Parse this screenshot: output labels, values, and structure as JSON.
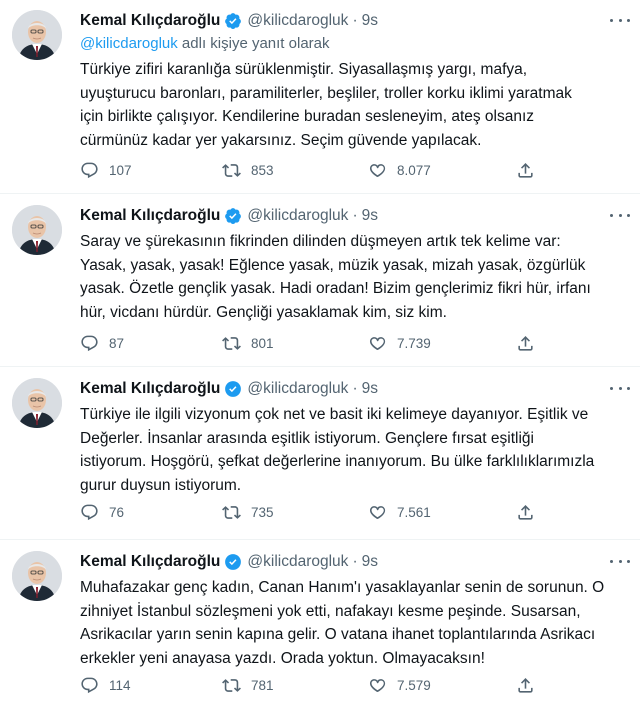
{
  "colors": {
    "accent": "#1d9bf0",
    "muted": "#536471",
    "text": "#0f1419",
    "divider": "#eff3f4"
  },
  "icons": {
    "verified": "verified-badge-icon",
    "reply": "reply-icon",
    "retweet": "retweet-icon",
    "like": "heart-icon",
    "share": "share-icon",
    "more": "more-icon"
  },
  "tweets": [
    {
      "name": "Kemal Kılıçdaroğlu",
      "handle": "@kilicdarogluk",
      "dot": "·",
      "time": "9s",
      "reply_mention": "@kilicdarogluk",
      "reply_suffix": " adlı kişiye yanıt olarak",
      "text": "Türkiye zifiri karanlığa sürüklenmiştir. Siyasallaşmış yargı, mafya,\nuyuşturucu baronları, paramiliterler, beşliler, troller korku iklimi yaratmak\niçin birlikte çalışıyor. Kendilerine buradan sesleneyim, ateş olsanız\ncürmünüz kadar yer yakarsınız. Seçim güvende yapılacak.",
      "replies": "107",
      "retweets": "853",
      "likes": "8.077"
    },
    {
      "name": "Kemal Kılıçdaroğlu",
      "handle": "@kilicdarogluk",
      "dot": "·",
      "time": "9s",
      "text": "Saray ve şürekasının fikrinden dilinden düşmeyen artık tek kelime var:\nYasak, yasak, yasak! Eğlence yasak, müzik yasak, mizah yasak, özgürlük\nyasak. Özetle gençlik yasak. Hadi oradan! Bizim gençlerimiz fikri hür, irfanı\nhür, vicdanı hürdür. Gençliği yasaklamak kim, siz kim.",
      "replies": "87",
      "retweets": "801",
      "likes": "7.739"
    },
    {
      "name": "Kemal Kılıçdaroğlu",
      "handle": "@kilicdarogluk",
      "dot": "·",
      "time": "9s",
      "text": "Türkiye ile ilgili vizyonum çok net ve basit iki kelimeye dayanıyor. Eşitlik ve\nDeğerler. İnsanlar arasında eşitlik istiyorum. Gençlere fırsat eşitliği\nistiyorum. Hoşgörü, şefkat değerlerine inanıyorum. Bu ülke farklılıklarımızla\ngurur duysun istiyorum.",
      "replies": "76",
      "retweets": "735",
      "likes": "7.561"
    },
    {
      "name": "Kemal Kılıçdaroğlu",
      "handle": "@kilicdarogluk",
      "dot": "·",
      "time": "9s",
      "text": "Muhafazakar genç kadın, Canan Hanım'ı yasaklayanlar senin de sorunun. O\nzihniyet İstanbul sözleşmeni yok etti, nafakayı kesme peşinde. Susarsan,\nAsrikacılar yarın senin kapına gelir. O vatana ihanet toplantılarında Asrikacı\nerkekler yeni anayasa yazdı. Orada yoktun. Olmayacaksın!",
      "replies": "114",
      "retweets": "781",
      "likes": "7.579"
    }
  ]
}
